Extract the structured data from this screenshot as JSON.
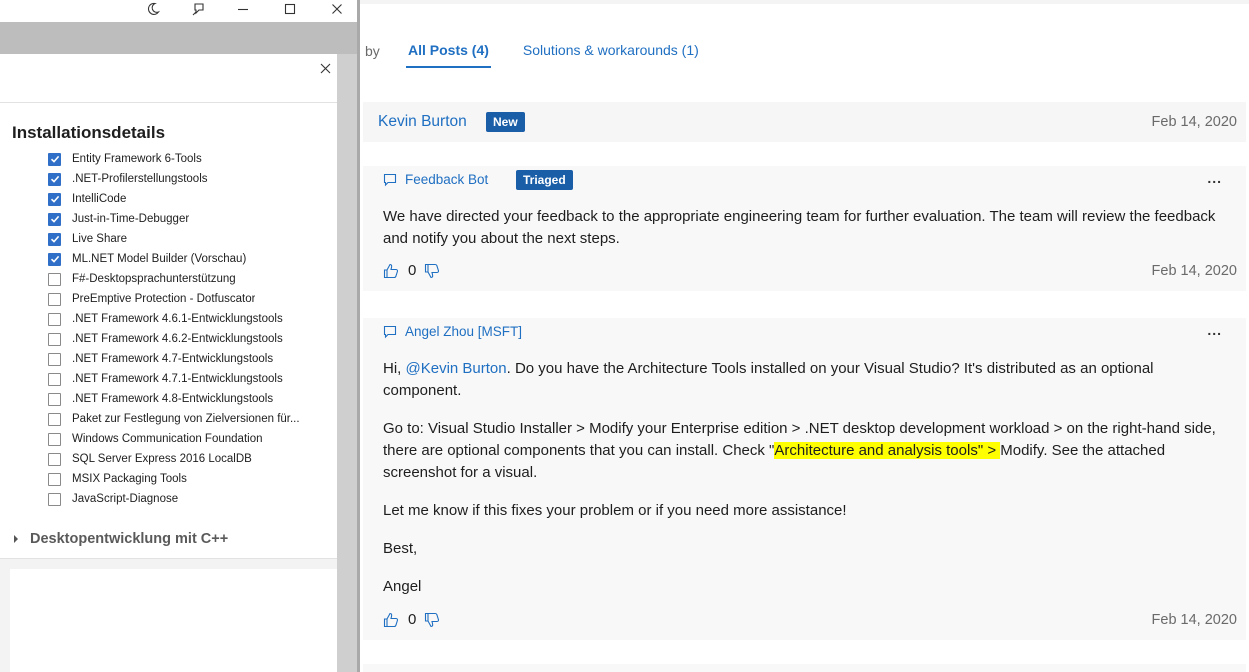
{
  "installer": {
    "details_heading": "Installationsdetails",
    "components": [
      {
        "label": "Entity Framework 6-Tools",
        "checked": true
      },
      {
        "label": ".NET-Profilerstellungstools",
        "checked": true
      },
      {
        "label": "IntelliCode",
        "checked": true
      },
      {
        "label": "Just-in-Time-Debugger",
        "checked": true
      },
      {
        "label": "Live Share",
        "checked": true
      },
      {
        "label": "ML.NET Model Builder (Vorschau)",
        "checked": true
      },
      {
        "label": "F#-Desktopsprachunterstützung",
        "checked": false
      },
      {
        "label": "PreEmptive Protection - Dotfuscator",
        "checked": false
      },
      {
        "label": ".NET Framework 4.6.1-Entwicklungstools",
        "checked": false
      },
      {
        "label": ".NET Framework 4.6.2-Entwicklungstools",
        "checked": false
      },
      {
        "label": ".NET Framework 4.7-Entwicklungstools",
        "checked": false
      },
      {
        "label": ".NET Framework 4.7.1-Entwicklungstools",
        "checked": false
      },
      {
        "label": ".NET Framework 4.8-Entwicklungstools",
        "checked": false
      },
      {
        "label": "Paket zur Festlegung von Zielversionen für...",
        "checked": false
      },
      {
        "label": "Windows Communication Foundation",
        "checked": false
      },
      {
        "label": "SQL Server Express 2016 LocalDB",
        "checked": false
      },
      {
        "label": "MSIX Packaging Tools",
        "checked": false
      },
      {
        "label": "JavaScript-Diagnose",
        "checked": false
      }
    ],
    "cpp_section": "Desktopentwicklung mit C++"
  },
  "feedback": {
    "sort_by_label": "by",
    "tabs": [
      {
        "label": "All Posts (4)",
        "active": true
      },
      {
        "label": "Solutions & workarounds (1)",
        "active": false
      }
    ],
    "post": {
      "author": "Kevin Burton",
      "badge": "New",
      "date": "Feb 14, 2020"
    },
    "comments": [
      {
        "author": "Feedback Bot",
        "badge": "Triaged",
        "more": "...",
        "body": "We have directed your feedback to the appropriate engineering team for further evaluation. The team will review the feedback and notify you about the next steps.",
        "votes": "0",
        "date": "Feb 14, 2020"
      },
      {
        "author": "Angel Zhou [MSFT]",
        "more": "...",
        "p1_greeting": "Hi, ",
        "p1_mention": "@Kevin Burton",
        "p1_rest": ". Do you have the Architecture Tools installed on your Visual Studio? It's distributed as an optional component.",
        "p2_before": "Go to: Visual Studio Installer > Modify your Enterprise edition > .NET desktop development workload > on the right-hand side, there are optional components that you can install. Check \"",
        "p2_highlight": "Architecture and analysis tools\" > ",
        "p2_after": "Modify. See the attached screenshot for a visual.",
        "p3": "Let me know if this fixes your problem or if you need more assistance!",
        "p4": "Best,",
        "p5": "Angel",
        "votes": "0",
        "date": "Feb 14, 2020"
      }
    ]
  },
  "colors": {
    "link": "#1f6fc2",
    "badge": "#1a5ea8",
    "checkbox": "#2f6fc7",
    "highlight": "#ffff00"
  },
  "icons": [
    "moon-icon",
    "pin-icon",
    "minimize-icon",
    "maximize-icon",
    "close-icon",
    "comment-icon",
    "thumbs-up-icon",
    "thumbs-down-icon",
    "expand-triangle-icon"
  ]
}
